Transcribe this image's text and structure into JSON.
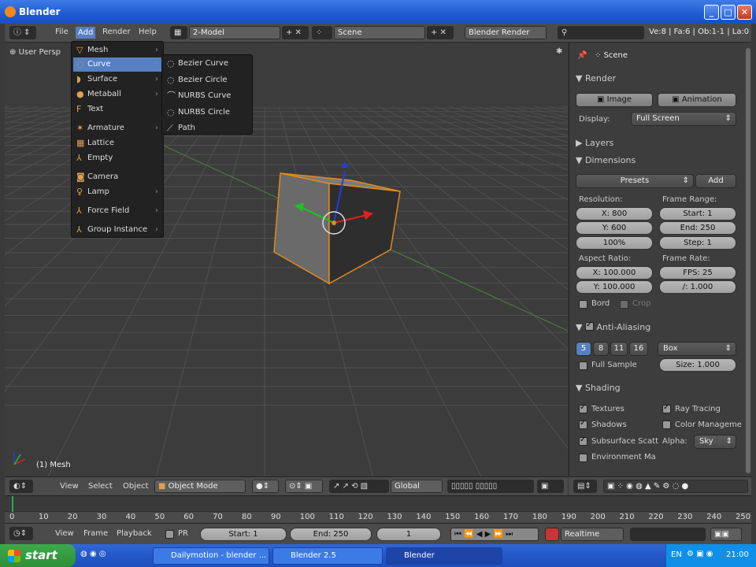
{
  "window": {
    "title": "Blender"
  },
  "info_header": {
    "menus": [
      "File",
      "Add",
      "Render",
      "Help"
    ],
    "screen": "2-Model",
    "scene": "Scene",
    "engine": "Blender Render",
    "stats": "Ve:8 | Fa:6 | Ob:1-1 | La:0"
  },
  "viewport": {
    "persp_label": "User Persp",
    "object_label": "(1) Mesh"
  },
  "add_menu": {
    "items": [
      {
        "label": "Mesh",
        "icon": "mesh-icon",
        "submenu": true
      },
      {
        "label": "Curve",
        "icon": "curve-icon",
        "submenu": true,
        "active": true
      },
      {
        "label": "Surface",
        "icon": "surface-icon",
        "submenu": true
      },
      {
        "label": "Metaball",
        "icon": "metaball-icon",
        "submenu": true
      },
      {
        "label": "Text",
        "icon": "text-icon",
        "submenu": false
      },
      {
        "label": "Armature",
        "icon": "armature-icon",
        "submenu": true
      },
      {
        "label": "Lattice",
        "icon": "lattice-icon",
        "submenu": false
      },
      {
        "label": "Empty",
        "icon": "empty-icon",
        "submenu": false
      },
      {
        "label": "Camera",
        "icon": "camera-icon",
        "submenu": false
      },
      {
        "label": "Lamp",
        "icon": "lamp-icon",
        "submenu": true
      },
      {
        "label": "Force Field",
        "icon": "force-field-icon",
        "submenu": true
      },
      {
        "label": "Group Instance",
        "icon": "group-instance-icon",
        "submenu": true
      }
    ]
  },
  "curve_submenu": {
    "items": [
      "Bezier Curve",
      "Bezier Circle",
      "NURBS Curve",
      "NURBS Circle",
      "Path"
    ]
  },
  "properties": {
    "context": "Scene",
    "render": {
      "header": "Render",
      "image_btn": "Image",
      "animation_btn": "Animation",
      "display_label": "Display:",
      "display_value": "Full Screen"
    },
    "layers_header": "Layers",
    "dimensions": {
      "header": "Dimensions",
      "presets": "Presets",
      "add": "Add",
      "resolution_label": "Resolution:",
      "res_x": "X: 800",
      "res_y": "Y: 600",
      "res_pct": "100%",
      "frame_range_label": "Frame Range:",
      "start": "Start: 1",
      "end": "End: 250",
      "step": "Step: 1",
      "aspect_label": "Aspect Ratio:",
      "asp_x": "X: 100.000",
      "asp_y": "Y: 100.000",
      "frame_rate_label": "Frame Rate:",
      "fps": "FPS: 25",
      "fps_base": "/: 1.000",
      "bord": "Bord",
      "crop": "Crop"
    },
    "anti_aliasing": {
      "header": "Anti-Aliasing",
      "samples": [
        "5",
        "8",
        "11",
        "16"
      ],
      "filter": "Box",
      "full_sample": "Full Sample",
      "size": "Size: 1.000"
    },
    "shading": {
      "header": "Shading",
      "textures": "Textures",
      "ray_tracing": "Ray Tracing",
      "shadows": "Shadows",
      "color_manage": "Color Manageme",
      "sss": "Subsurface Scatt",
      "alpha_label": "Alpha:",
      "alpha_value": "Sky",
      "env_map": "Environment Ma"
    }
  },
  "view3d_header": {
    "menus": [
      "View",
      "Select",
      "Object"
    ],
    "mode": "Object Mode",
    "orientation": "Global"
  },
  "timeline": {
    "ticks": [
      "0",
      "10",
      "20",
      "30",
      "40",
      "50",
      "60",
      "70",
      "80",
      "90",
      "100",
      "110",
      "120",
      "130",
      "140",
      "150",
      "160",
      "170",
      "180",
      "190",
      "200",
      "210",
      "220",
      "230",
      "240",
      "250"
    ],
    "menus": [
      "View",
      "Frame",
      "Playback"
    ],
    "pr": "PR",
    "start": "Start: 1",
    "end": "End: 250",
    "current": "1",
    "sync": "Realtime"
  },
  "taskbar": {
    "start": "start",
    "tasks": [
      "Dailymotion - blender ...",
      "Blender 2.5",
      "Blender"
    ],
    "lang": "EN",
    "clock": "21:00"
  }
}
